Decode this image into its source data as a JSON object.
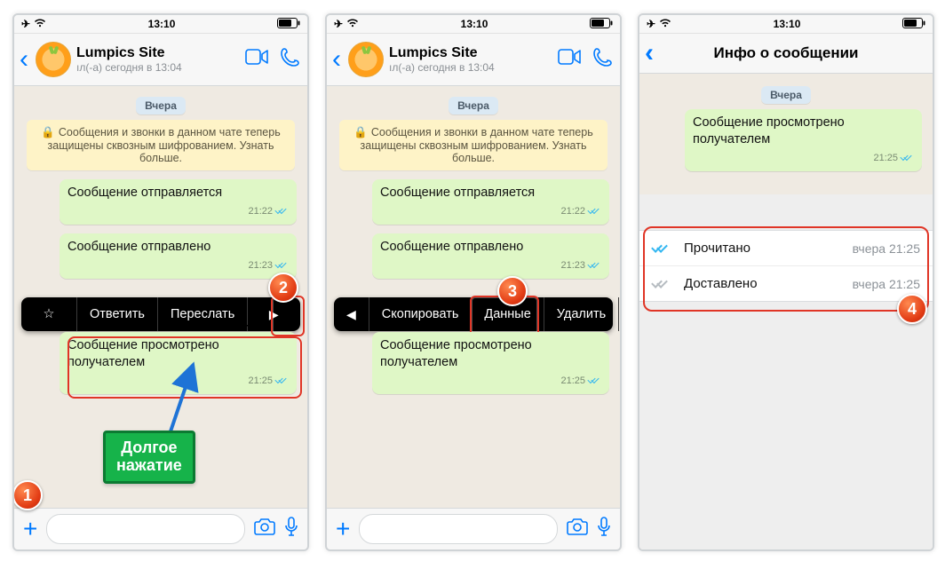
{
  "status": {
    "time": "13:10"
  },
  "chat": {
    "title": "Lumpics Site",
    "subtitle": "ıл(-а) сегодня в 13:04",
    "day_chip": "Вчера",
    "encryption": "Сообщения и звонки в данном чате теперь защищены сквозным шифрованием. Узнать больше.",
    "msg1": {
      "text": "Сообщение отправляется",
      "time": "21:22"
    },
    "msg2": {
      "text": "Сообщение отправлено",
      "time": "21:23"
    },
    "msg3": {
      "text": "Сообщение просмотрено получателем",
      "time": "21:25"
    }
  },
  "context_menu_1": {
    "reply": "Ответить",
    "forward": "Переслать"
  },
  "context_menu_2": {
    "copy": "Скопировать",
    "info": "Данные",
    "delete": "Удалить"
  },
  "callout": {
    "line1": "Долгое",
    "line2": "нажатие"
  },
  "info_screen": {
    "title": "Инфо о сообщении",
    "day_chip": "Вчера",
    "bubble": {
      "text": "Сообщение просмотрено получателем",
      "time": "21:25"
    },
    "read": {
      "label": "Прочитано",
      "ts": "вчера 21:25"
    },
    "delivered": {
      "label": "Доставлено",
      "ts": "вчера 21:25"
    }
  },
  "badges": {
    "b1": "1",
    "b2": "2",
    "b3": "3",
    "b4": "4"
  }
}
